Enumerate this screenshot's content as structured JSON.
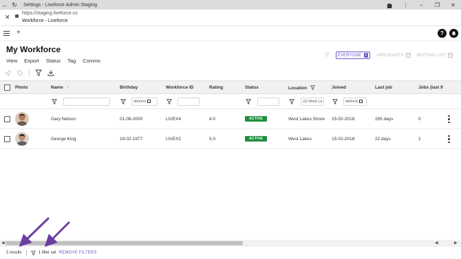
{
  "browser": {
    "window_title": "Settings - Liveforce Admin Staging",
    "url": "https://staging.liveforce.co",
    "page_title": "Workforce - Liveforce"
  },
  "header": {
    "title": "My Workforce",
    "menu": [
      "View",
      "Export",
      "Status",
      "Tag",
      "Comms"
    ]
  },
  "view_tabs": [
    {
      "label": "EVERYONE",
      "count": "2",
      "active": true
    },
    {
      "label": "APPLICANTS",
      "count": "0",
      "active": false
    },
    {
      "label": "WAITING LIST",
      "count": "0",
      "active": false
    }
  ],
  "table": {
    "columns": [
      "Photo",
      "Name",
      "Birthday",
      "Workforce ID",
      "Rating",
      "Status",
      "Location",
      "Joined",
      "Last job",
      "Jobs (last 9"
    ],
    "filters": {
      "birthday_placeholder": "dd/mm/",
      "location_value": "(2) West La",
      "joined_placeholder": "dd/mm/"
    },
    "rows": [
      {
        "name": "Gary Nelson",
        "birthday": "01-08-2000",
        "workforce_id": "LIVEX4",
        "rating": "4.0",
        "status": "ACTIVE",
        "location": "West Lakes Shore",
        "joined": "15-02-2018",
        "last_job": "285 days",
        "jobs": "0"
      },
      {
        "name": "George King",
        "birthday": "19-02-1977",
        "workforce_id": "LIVEX2",
        "rating": "5.0",
        "status": "ACTIVE",
        "location": "West Lakes",
        "joined": "15-02-2018",
        "last_job": "22 days",
        "jobs": "1"
      }
    ]
  },
  "footer": {
    "results": "2 results",
    "filter_count": "1 filter set",
    "remove_filters": "REMOVE FILTERS"
  },
  "colors": {
    "accent": "#6a5acd",
    "active_badge": "#1e8e3e",
    "annotation_arrow": "#6b3fa0"
  }
}
